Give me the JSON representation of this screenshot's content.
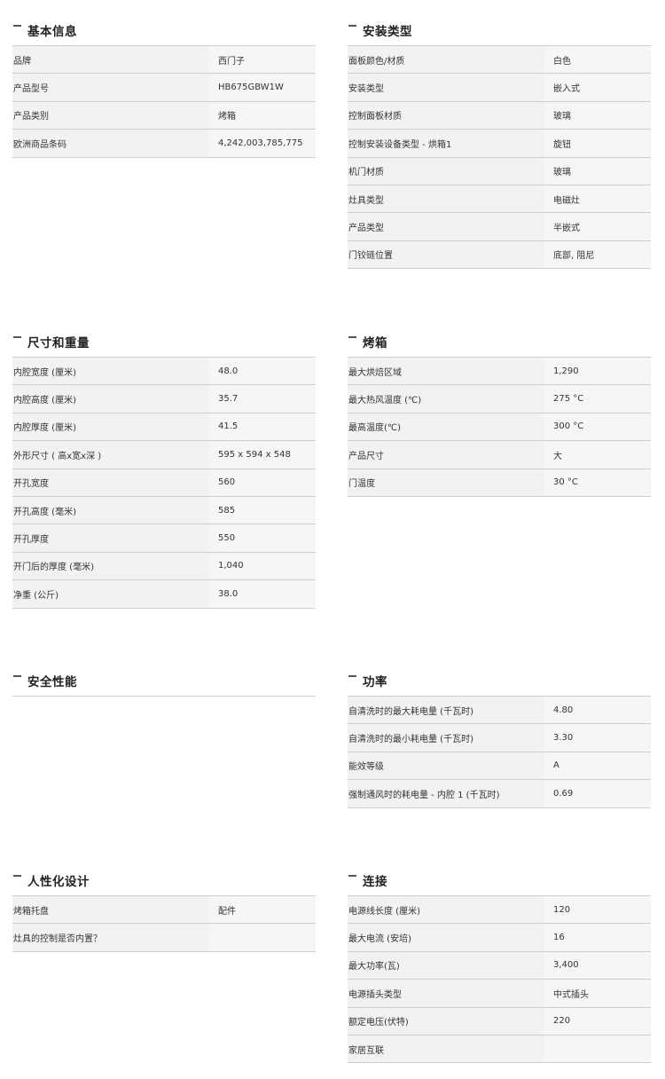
{
  "sections": {
    "basic": {
      "title": "基本信息",
      "rows": [
        {
          "label": "品牌",
          "value": "西门子"
        },
        {
          "label": "产品型号",
          "value": "HB675GBW1W"
        },
        {
          "label": "产品类别",
          "value": "烤箱"
        },
        {
          "label": "欧洲商品条码",
          "value": "4,242,003,785,775"
        }
      ]
    },
    "install": {
      "title": "安装类型",
      "rows": [
        {
          "label": "面板颜色/材质",
          "value": "白色"
        },
        {
          "label": "安装类型",
          "value": "嵌入式"
        },
        {
          "label": "控制面板材质",
          "value": "玻璃"
        },
        {
          "label": "控制安装设备类型 - 烘箱1",
          "value": "旋钮"
        },
        {
          "label": "机门材质",
          "value": "玻璃"
        },
        {
          "label": "灶具类型",
          "value": "电磁灶"
        },
        {
          "label": "产品类型",
          "value": "半嵌式"
        },
        {
          "label": "门铰链位置",
          "value": "底部, 阻尼"
        }
      ]
    },
    "dimensions": {
      "title": "尺寸和重量",
      "rows": [
        {
          "label": "内腔宽度 (厘米)",
          "value": "48.0"
        },
        {
          "label": "内腔高度 (厘米)",
          "value": "35.7"
        },
        {
          "label": "内腔厚度 (厘米)",
          "value": "41.5"
        },
        {
          "label": "外形尺寸 ( 高x宽x深 )",
          "value": "595 x 594 x 548"
        },
        {
          "label": "开孔宽度",
          "value": "560"
        },
        {
          "label": "开孔高度 (毫米)",
          "value": "585"
        },
        {
          "label": "开孔厚度",
          "value": "550"
        },
        {
          "label": "开门后的厚度 (毫米)",
          "value": "1,040"
        },
        {
          "label": "净重 (公斤)",
          "value": "38.0"
        }
      ]
    },
    "oven": {
      "title": "烤箱",
      "rows": [
        {
          "label": "最大烘焙区域",
          "value": "1,290"
        },
        {
          "label": "最大热风温度 (℃)",
          "value": "275 °C"
        },
        {
          "label": "最高温度(℃)",
          "value": "300 °C"
        },
        {
          "label": "产品尺寸",
          "value": "大"
        },
        {
          "label": "门温度",
          "value": "30 °C"
        }
      ]
    },
    "safety": {
      "title": "安全性能",
      "rows": []
    },
    "power": {
      "title": "功率",
      "rows": [
        {
          "label": "自清洗时的最大耗电量 (千瓦时)",
          "value": "4.80"
        },
        {
          "label": "自清洗时的最小耗电量 (千瓦时)",
          "value": "3.30"
        },
        {
          "label": "能效等级",
          "value": "A"
        },
        {
          "label": "强制通风时的耗电量 - 内腔 1 (千瓦时)",
          "value": "0.69"
        }
      ]
    },
    "design": {
      "title": "人性化设计",
      "rows": [
        {
          "label": "烤箱托盘",
          "value": "配件"
        },
        {
          "label": "灶具的控制是否内置？",
          "value": ""
        }
      ]
    },
    "connect": {
      "title": "连接",
      "rows": [
        {
          "label": "电源线长度 (厘米)",
          "value": "120"
        },
        {
          "label": "最大电流 (安培)",
          "value": "16"
        },
        {
          "label": "最大功率(瓦)",
          "value": "3,400"
        },
        {
          "label": "电源插头类型",
          "value": "中式插头"
        },
        {
          "label": "额定电压(伏特)",
          "value": "220"
        },
        {
          "label": "家居互联",
          "value": ""
        }
      ]
    }
  }
}
